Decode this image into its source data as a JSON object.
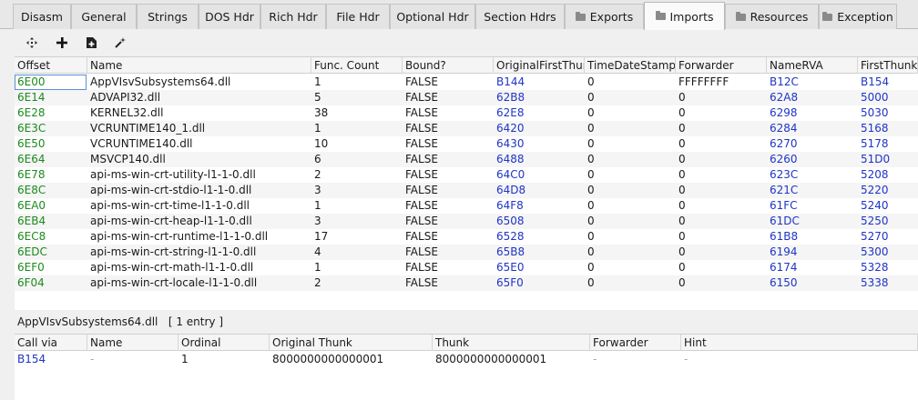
{
  "tabs": [
    {
      "label": "Disasm",
      "icon": null,
      "active": false
    },
    {
      "label": "General",
      "icon": null,
      "active": false
    },
    {
      "label": "Strings",
      "icon": null,
      "active": false
    },
    {
      "label": "DOS Hdr",
      "icon": null,
      "active": false
    },
    {
      "label": "Rich Hdr",
      "icon": null,
      "active": false
    },
    {
      "label": "File Hdr",
      "icon": null,
      "active": false
    },
    {
      "label": "Optional Hdr",
      "icon": null,
      "active": false
    },
    {
      "label": "Section Hdrs",
      "icon": null,
      "active": false
    },
    {
      "label": "Exports",
      "icon": "folder-icon",
      "active": false
    },
    {
      "label": "Imports",
      "icon": "folder-icon",
      "active": true
    },
    {
      "label": "Resources",
      "icon": "folder-icon",
      "active": false
    },
    {
      "label": "Exception",
      "icon": "folder-icon",
      "active": false
    }
  ],
  "toolbar": {
    "buttons": [
      "move-icon",
      "add-icon",
      "add-file-icon",
      "magic-wand-icon"
    ]
  },
  "imports_table": {
    "columns": [
      "Offset",
      "Name",
      "Func. Count",
      "Bound?",
      "OriginalFirstThunk",
      "TimeDateStamp",
      "Forwarder",
      "NameRVA",
      "FirstThunk"
    ],
    "rows": [
      [
        "6E00",
        "AppVIsvSubsystems64.dll",
        "1",
        "FALSE",
        "B144",
        "0",
        "FFFFFFFF",
        "B12C",
        "B154"
      ],
      [
        "6E14",
        "ADVAPI32.dll",
        "5",
        "FALSE",
        "62B8",
        "0",
        "0",
        "62A8",
        "5000"
      ],
      [
        "6E28",
        "KERNEL32.dll",
        "38",
        "FALSE",
        "62E8",
        "0",
        "0",
        "6298",
        "5030"
      ],
      [
        "6E3C",
        "VCRUNTIME140_1.dll",
        "1",
        "FALSE",
        "6420",
        "0",
        "0",
        "6284",
        "5168"
      ],
      [
        "6E50",
        "VCRUNTIME140.dll",
        "10",
        "FALSE",
        "6430",
        "0",
        "0",
        "6270",
        "5178"
      ],
      [
        "6E64",
        "MSVCP140.dll",
        "6",
        "FALSE",
        "6488",
        "0",
        "0",
        "6260",
        "51D0"
      ],
      [
        "6E78",
        "api-ms-win-crt-utility-l1-1-0.dll",
        "2",
        "FALSE",
        "64C0",
        "0",
        "0",
        "623C",
        "5208"
      ],
      [
        "6E8C",
        "api-ms-win-crt-stdio-l1-1-0.dll",
        "3",
        "FALSE",
        "64D8",
        "0",
        "0",
        "621C",
        "5220"
      ],
      [
        "6EA0",
        "api-ms-win-crt-time-l1-1-0.dll",
        "1",
        "FALSE",
        "64F8",
        "0",
        "0",
        "61FC",
        "5240"
      ],
      [
        "6EB4",
        "api-ms-win-crt-heap-l1-1-0.dll",
        "3",
        "FALSE",
        "6508",
        "0",
        "0",
        "61DC",
        "5250"
      ],
      [
        "6EC8",
        "api-ms-win-crt-runtime-l1-1-0.dll",
        "17",
        "FALSE",
        "6528",
        "0",
        "0",
        "61B8",
        "5270"
      ],
      [
        "6EDC",
        "api-ms-win-crt-string-l1-1-0.dll",
        "4",
        "FALSE",
        "65B8",
        "0",
        "0",
        "6194",
        "5300"
      ],
      [
        "6EF0",
        "api-ms-win-crt-math-l1-1-0.dll",
        "1",
        "FALSE",
        "65E0",
        "0",
        "0",
        "6174",
        "5328"
      ],
      [
        "6F04",
        "api-ms-win-crt-locale-l1-1-0.dll",
        "2",
        "FALSE",
        "65F0",
        "0",
        "0",
        "6150",
        "5338"
      ]
    ]
  },
  "details": {
    "caption": "AppVIsvSubsystems64.dll   [ 1 entry ]",
    "columns": [
      "Call via",
      "Name",
      "Ordinal",
      "Original Thunk",
      "Thunk",
      "Forwarder",
      "Hint"
    ],
    "rows": [
      [
        "B154",
        "-",
        "1",
        "8000000000000001",
        "8000000000000001",
        "-",
        "-"
      ]
    ]
  },
  "colors": {
    "offset_text": "#1c8a1c",
    "rva_text": "#1f35c4",
    "placeholder_text": "#a8a8a8"
  }
}
